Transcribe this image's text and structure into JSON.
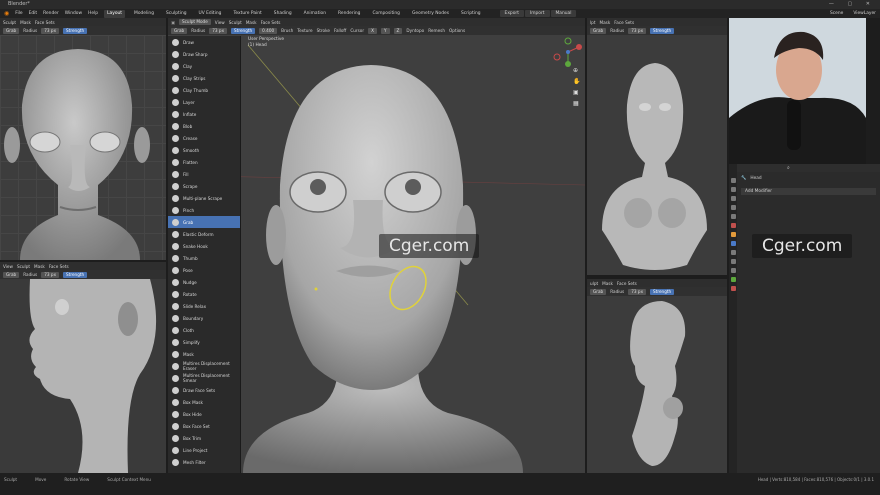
{
  "window": {
    "title": "Blender*"
  },
  "menu": [
    "File",
    "Edit",
    "Render",
    "Window",
    "Help"
  ],
  "workspaces": [
    {
      "label": "Layout",
      "active": true
    },
    {
      "label": "Modeling"
    },
    {
      "label": "Sculpting"
    },
    {
      "label": "UV Editing"
    },
    {
      "label": "Texture Paint"
    },
    {
      "label": "Shading"
    },
    {
      "label": "Animation"
    },
    {
      "label": "Rendering"
    },
    {
      "label": "Compositing"
    },
    {
      "label": "Geometry Nodes"
    },
    {
      "label": "Scripting"
    }
  ],
  "export_group": [
    "Export",
    "Import",
    "Manual"
  ],
  "scene": {
    "scene": "Scene",
    "view_layer": "ViewLayer"
  },
  "viewport_header": {
    "mode": "Sculpt Mode",
    "items": [
      "View",
      "Sculpt",
      "Mask",
      "Face Sets"
    ]
  },
  "left_header": {
    "mode": "Sculpt",
    "items": [
      "Mask",
      "Face Sets"
    ]
  },
  "left_bottom_header": {
    "items": [
      "View",
      "Sculpt",
      "Mask",
      "Face Sets"
    ]
  },
  "right_bottom_header": {
    "items": [
      "ulpt",
      "Mask",
      "Face Sets"
    ]
  },
  "right_top_header": {
    "items": [
      "lpt",
      "Mask",
      "Face Sets"
    ]
  },
  "tool_settings": {
    "brush": "Grab",
    "radius_label": "Radius",
    "radius_value": "73 px",
    "strength_label": "Strength",
    "strength_value": "0.400",
    "menus": [
      "Brush",
      "Texture",
      "Stroke",
      "Falloff",
      "Cursor"
    ],
    "axes": [
      "X",
      "Y",
      "Z"
    ],
    "right_menus": [
      "Dyntopo",
      "Remesh",
      "Options"
    ]
  },
  "viewport_info": {
    "line1": "User Perspective",
    "line2": "(1) Head"
  },
  "tools": [
    {
      "label": "Draw"
    },
    {
      "label": "Draw Sharp"
    },
    {
      "label": "Clay"
    },
    {
      "label": "Clay Strips"
    },
    {
      "label": "Clay Thumb"
    },
    {
      "label": "Layer"
    },
    {
      "label": "Inflate"
    },
    {
      "label": "Blob"
    },
    {
      "label": "Crease"
    },
    {
      "label": "Smooth"
    },
    {
      "label": "Flatten"
    },
    {
      "label": "Fill"
    },
    {
      "label": "Scrape"
    },
    {
      "label": "Multi-plane Scrape"
    },
    {
      "label": "Pinch"
    },
    {
      "label": "Grab",
      "active": true
    },
    {
      "label": "Elastic Deform"
    },
    {
      "label": "Snake Hook"
    },
    {
      "label": "Thumb"
    },
    {
      "label": "Pose"
    },
    {
      "label": "Nudge"
    },
    {
      "label": "Rotate"
    },
    {
      "label": "Slide Relax"
    },
    {
      "label": "Boundary"
    },
    {
      "label": "Cloth"
    },
    {
      "label": "Simplify"
    },
    {
      "label": "Mask"
    },
    {
      "label": "Multires Displacement Eraser"
    },
    {
      "label": "Multires Displacement Smear"
    },
    {
      "label": "Draw Face Sets"
    },
    {
      "label": "Box Mask"
    },
    {
      "label": "Box Hide"
    },
    {
      "label": "Box Face Set"
    },
    {
      "label": "Box Trim"
    },
    {
      "label": "Line Project"
    },
    {
      "label": "Mesh Filter"
    }
  ],
  "properties": {
    "object": "Head",
    "add_modifier": "Add Modifier"
  },
  "watermarks": [
    "Cger.com",
    "Cger.com"
  ],
  "statusbar": {
    "items": [
      "Sculpt",
      "Move",
      "Rotate View",
      "Sculpt Context Menu"
    ],
    "right": "Head | Verts:810,584 | Faces:810,576 | Objects:0/1 | 3.0.1"
  },
  "colors": {
    "accent": "#4772b3",
    "viewport": "#3d3d3d",
    "brush_circle": "#e0d23a"
  }
}
